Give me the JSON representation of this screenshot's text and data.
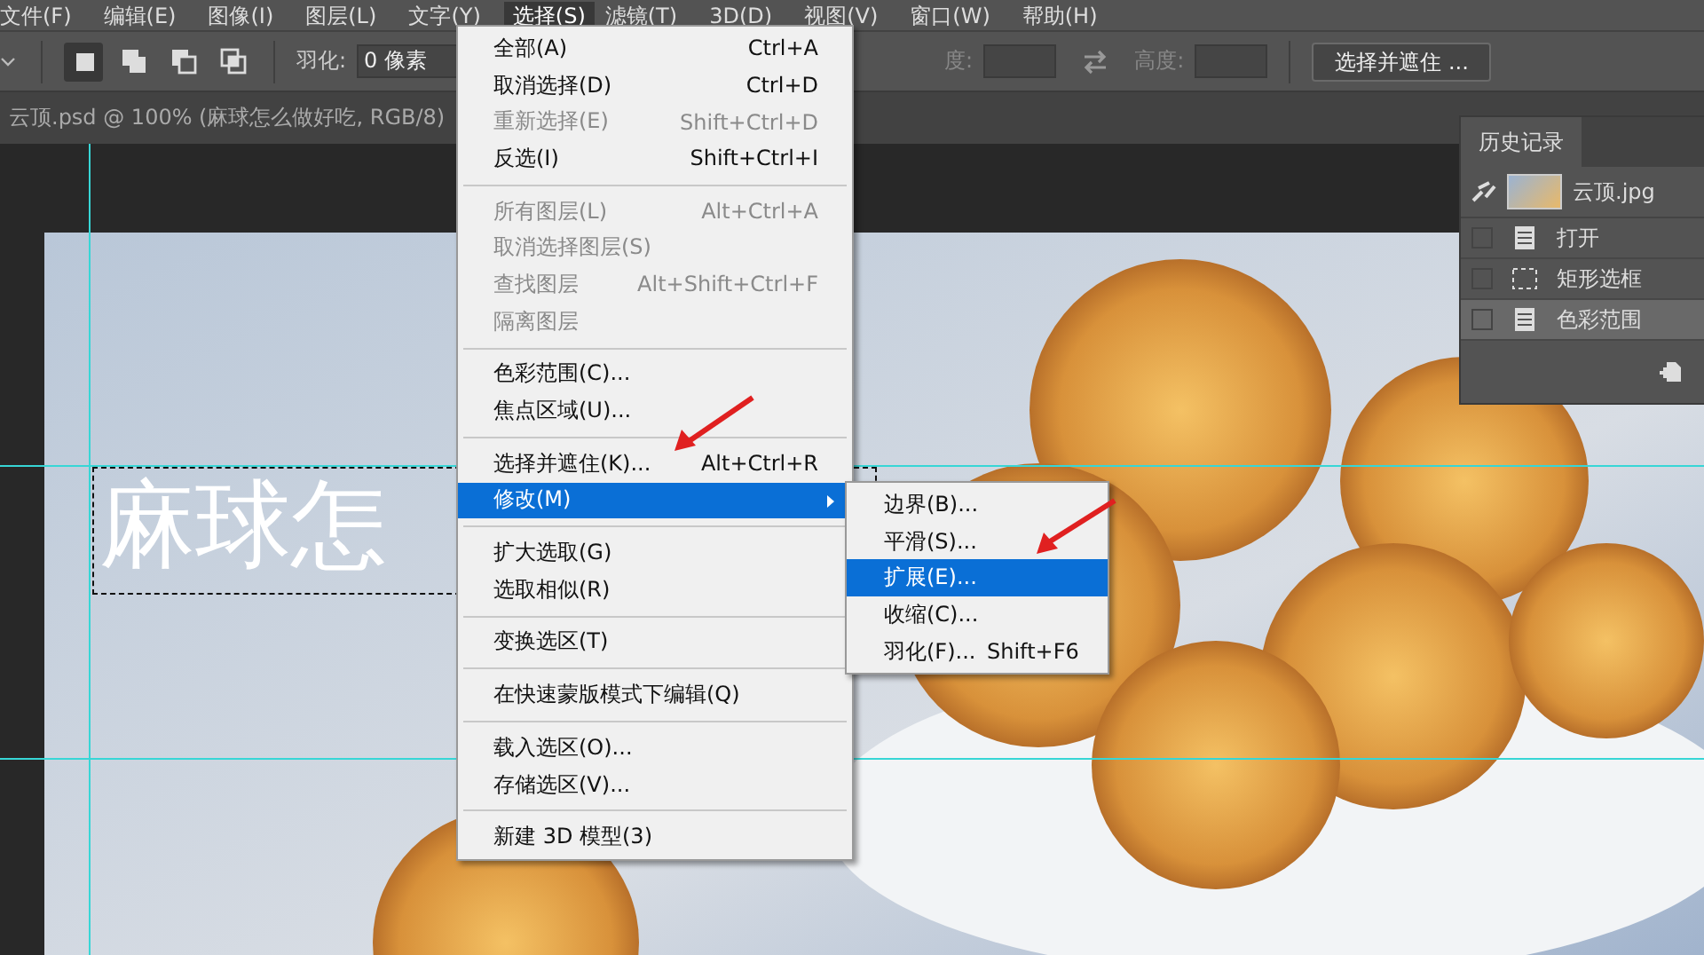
{
  "menu_bar": [
    {
      "label": "文件(F)",
      "selected": false
    },
    {
      "label": "编辑(E)",
      "selected": false
    },
    {
      "label": "图像(I)",
      "selected": false
    },
    {
      "label": "图层(L)",
      "selected": false
    },
    {
      "label": "文字(Y)",
      "selected": false
    },
    {
      "label": "选择(S)",
      "selected": true
    },
    {
      "label": "滤镜(T)",
      "selected": false
    },
    {
      "label": "3D(D)",
      "selected": false
    },
    {
      "label": "视图(V)",
      "selected": false
    },
    {
      "label": "窗口(W)",
      "selected": false
    },
    {
      "label": "帮助(H)",
      "selected": false
    }
  ],
  "options_bar": {
    "modes": [
      {
        "kind": "new",
        "selected": true
      },
      {
        "kind": "add",
        "selected": false
      },
      {
        "kind": "subtract",
        "selected": false
      },
      {
        "kind": "intersect",
        "selected": false
      }
    ],
    "feather_label": "羽化:",
    "feather_value": "0 像素",
    "width_label": "度:",
    "height_label": "高度:",
    "refine_button": "选择并遮住 ..."
  },
  "document_tab": {
    "title": "云顶.psd @ 100% (麻球怎么做好吃, RGB/8)"
  },
  "canvas": {
    "text": "麻球怎"
  },
  "select_menu": [
    {
      "kind": "item",
      "label": "全部(A)",
      "shortcut": "Ctrl+A",
      "disabled": false,
      "selected": false
    },
    {
      "kind": "item",
      "label": "取消选择(D)",
      "shortcut": "Ctrl+D",
      "disabled": false,
      "selected": false
    },
    {
      "kind": "item",
      "label": "重新选择(E)",
      "shortcut": "Shift+Ctrl+D",
      "disabled": true,
      "selected": false
    },
    {
      "kind": "item",
      "label": "反选(I)",
      "shortcut": "Shift+Ctrl+I",
      "disabled": false,
      "selected": false
    },
    {
      "kind": "separator"
    },
    {
      "kind": "item",
      "label": "所有图层(L)",
      "shortcut": "Alt+Ctrl+A",
      "disabled": true,
      "selected": false
    },
    {
      "kind": "item",
      "label": "取消选择图层(S)",
      "disabled": true,
      "selected": false
    },
    {
      "kind": "item",
      "label": "查找图层",
      "shortcut": "Alt+Shift+Ctrl+F",
      "disabled": true,
      "selected": false
    },
    {
      "kind": "item",
      "label": "隔离图层",
      "disabled": true,
      "selected": false
    },
    {
      "kind": "separator"
    },
    {
      "kind": "item",
      "label": "色彩范围(C)...",
      "disabled": false,
      "selected": false
    },
    {
      "kind": "item",
      "label": "焦点区域(U)...",
      "disabled": false,
      "selected": false
    },
    {
      "kind": "separator"
    },
    {
      "kind": "item",
      "label": "选择并遮住(K)...",
      "shortcut": "Alt+Ctrl+R",
      "disabled": false,
      "selected": false
    },
    {
      "kind": "submenu",
      "label": "修改(M)",
      "disabled": false,
      "selected": true
    },
    {
      "kind": "separator"
    },
    {
      "kind": "item",
      "label": "扩大选取(G)",
      "disabled": false,
      "selected": false
    },
    {
      "kind": "item",
      "label": "选取相似(R)",
      "disabled": false,
      "selected": false
    },
    {
      "kind": "separator"
    },
    {
      "kind": "item",
      "label": "变换选区(T)",
      "disabled": false,
      "selected": false
    },
    {
      "kind": "separator"
    },
    {
      "kind": "item",
      "label": "在快速蒙版模式下编辑(Q)",
      "disabled": false,
      "selected": false
    },
    {
      "kind": "separator"
    },
    {
      "kind": "item",
      "label": "载入选区(O)...",
      "disabled": false,
      "selected": false
    },
    {
      "kind": "item",
      "label": "存储选区(V)...",
      "disabled": false,
      "selected": false
    },
    {
      "kind": "separator"
    },
    {
      "kind": "item",
      "label": "新建 3D 模型(3)",
      "disabled": false,
      "selected": false
    }
  ],
  "modify_submenu": [
    {
      "label": "边界(B)...",
      "selected": false
    },
    {
      "label": "平滑(S)...",
      "selected": false
    },
    {
      "label": "扩展(E)...",
      "selected": true
    },
    {
      "label": "收缩(C)...",
      "selected": false
    },
    {
      "label": "羽化(F)...",
      "shortcut": "Shift+F6",
      "selected": false
    }
  ],
  "history_panel": {
    "tab": "历史记录",
    "snapshot": "云顶.jpg",
    "states": [
      {
        "kind": "document",
        "label": "打开",
        "selected": false
      },
      {
        "kind": "marquee",
        "label": "矩形选框",
        "selected": false
      },
      {
        "kind": "document",
        "label": "色彩范围",
        "selected": true
      }
    ]
  }
}
